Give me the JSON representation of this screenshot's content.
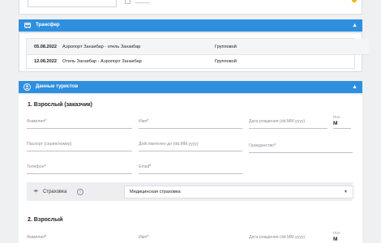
{
  "transfer": {
    "title": "Трансфер",
    "rows": [
      {
        "date": "05.08.2022",
        "route": "Аэропорт Занзибар - отель Занзибар",
        "type": "Групповой"
      },
      {
        "date": "12.08.2022",
        "route": "Отель Занзибар - Аэропорт Занзибар",
        "type": "Групповой"
      }
    ]
  },
  "tourists": {
    "title": "Данные туристов",
    "tourist1": {
      "heading": "1. Взрослый (заказчик)",
      "surname": "Фамилия",
      "name": "Имя",
      "birth": "Дата рождения (dd.MM.yyyy)",
      "gender_label": "Пол",
      "gender_value": "М",
      "passport": "Паспорт (серия/номер)",
      "valid": "Действителен до (dd.MM.yyyy)",
      "citizenship": "Гражданство",
      "phone": "Телефон",
      "email": "Email",
      "insurance_label": "Страховка",
      "insurance_value": "Медицинская страховка"
    },
    "tourist2": {
      "heading": "2. Взрослый",
      "surname": "Фамилия",
      "name": "Имя",
      "birth": "Дата рождения (dd.MM.yyyy)",
      "gender_label": "Пол",
      "gender_value": "М"
    }
  },
  "required_mark": "*",
  "colors": {
    "accent": "#2f8fdf",
    "required": "#e53935"
  }
}
